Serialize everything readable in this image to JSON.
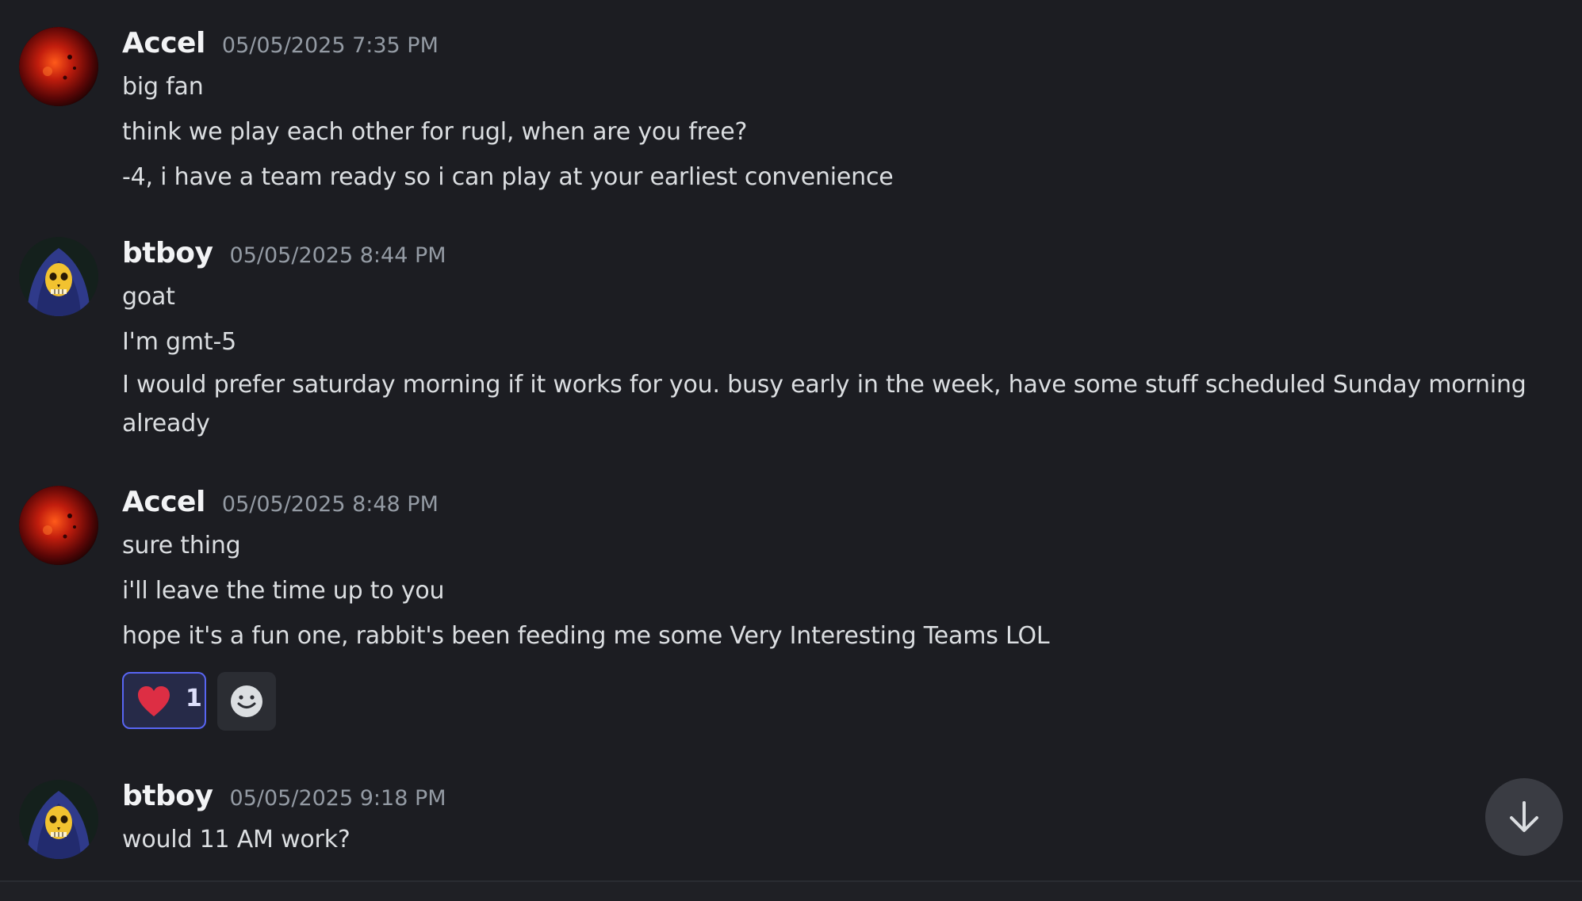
{
  "messages": [
    {
      "author": "Accel",
      "timestamp": "05/05/2025 7:35 PM",
      "avatar_icon": "red-planet-avatar",
      "lines": [
        "big fan",
        "think we play each other for rugl, when are you free?",
        "-4, i have a team ready so i can play at your earliest convenience"
      ]
    },
    {
      "author": "btboy",
      "timestamp": "05/05/2025 8:44 PM",
      "avatar_icon": "skeletor-avatar",
      "lines": [
        "goat",
        "I'm gmt-5",
        "I would prefer saturday morning if it works for you. busy early in the week, have some stuff scheduled Sunday morning already"
      ]
    },
    {
      "author": "Accel",
      "timestamp": "05/05/2025 8:48 PM",
      "avatar_icon": "red-planet-avatar",
      "lines": [
        "sure thing",
        "i'll leave the time up to you",
        "hope it's a fun one, rabbit's been feeding me some Very Interesting Teams LOL"
      ],
      "reactions": [
        {
          "emoji": "heart-icon",
          "count": "1",
          "selected": true
        }
      ]
    },
    {
      "author": "btboy",
      "timestamp": "05/05/2025 9:18 PM",
      "avatar_icon": "skeletor-avatar",
      "lines": [
        "would 11 AM work?"
      ]
    }
  ],
  "controls": {
    "add_reaction_icon": "add-reaction-icon",
    "jump_to_present_icon": "arrow-down-icon"
  },
  "colors": {
    "background": "#1c1d22",
    "username": "#f2f3f5",
    "timestamp": "#949ba4",
    "message_text": "#dbdee1",
    "reaction_border": "#5865f2",
    "reaction_bg": "#262a48",
    "heart": "#dd2e44"
  }
}
